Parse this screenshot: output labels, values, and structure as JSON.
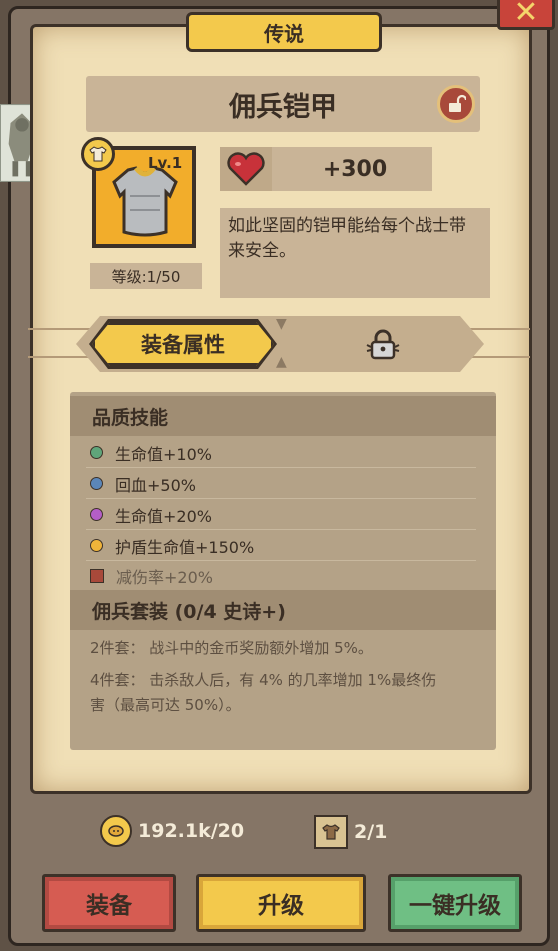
{
  "header": {
    "rarity": "传说",
    "close_icon": "close-x-icon"
  },
  "item": {
    "name": "佣兵铠甲",
    "level_badge": "Lv.1",
    "level_text": "等级:1/50",
    "type_icon": "shirt-icon",
    "image_icon": "chest-armor-icon",
    "lock_icon": "unlocked-padlock-icon"
  },
  "stat": {
    "icon": "heart-icon",
    "value": "+300"
  },
  "description": "如此坚固的铠甲能给每个战士带来安全。",
  "tabs": {
    "active_label": "装备属性",
    "locked_tab_icon": "padlock-icon"
  },
  "quality_skills": {
    "title": "品质技能",
    "items": [
      {
        "label": "生命值+10%",
        "color": "#5fa57a",
        "locked": false
      },
      {
        "label": "回血+50%",
        "color": "#5b86b8",
        "locked": false
      },
      {
        "label": "生命值+20%",
        "color": "#b45ec6",
        "locked": false
      },
      {
        "label": "护盾生命值+150%",
        "color": "#f0b43a",
        "locked": false
      },
      {
        "label": "减伤率+20%",
        "color": "#a8493a",
        "locked": true
      }
    ]
  },
  "set_bonus": {
    "title": "佣兵套装 (0/4 史诗+)",
    "lines": [
      "2件套：  战斗中的金币奖励额外增加 5%。",
      "4件套：  击杀敌人后，有 4% 的几率增加 1%最终伤",
      "害（最高可达 50%）。"
    ]
  },
  "resources": {
    "gold": "192.1k/20",
    "gold_icon": "coin-icon",
    "scrolls": "2/1",
    "scroll_icon": "armor-scroll-icon"
  },
  "buttons": {
    "equip": "装备",
    "upgrade": "升级",
    "one_click_upgrade": "一键升级"
  },
  "colors": {
    "parchment": "#f0dfb6",
    "gold": "#f3c94c",
    "equip_red": "#d65c52",
    "upgrade_gold": "#f3c94c",
    "oneclick_green": "#6fbf84"
  }
}
